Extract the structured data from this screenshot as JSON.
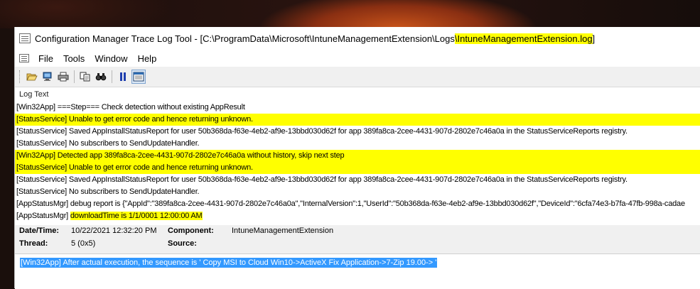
{
  "window": {
    "title_prefix": "Configuration Manager Trace Log Tool - [C:\\ProgramData\\Microsoft\\IntuneManagementExtension\\Logs",
    "title_highlight": "\\IntuneManagementExtension.log",
    "title_suffix": "]"
  },
  "menu": {
    "items": [
      "File",
      "Tools",
      "Window",
      "Help"
    ]
  },
  "toolbar": {
    "buttons": [
      "open-icon",
      "open-network-icon",
      "print-icon",
      "copy-icon",
      "find-icon",
      "pause-icon",
      "filter-icon"
    ]
  },
  "log": {
    "header": "Log Text",
    "rows": [
      {
        "pre": "[Win32App] ===Step=== Check detection without existing AppResult",
        "hl": "",
        "post": "",
        "highlight": false
      },
      {
        "pre": "[StatusService] Unable to get error code and hence returning unknown.",
        "hl": "",
        "post": "",
        "highlight": true
      },
      {
        "pre": "[StatusService] Saved AppInstallStatusReport for user 50b368da-f63e-4eb2-af9e-13bbd030d62f for app 389fa8ca-2cee-4431-907d-2802e7c46a0a in the StatusServiceReports registry.",
        "hl": "",
        "post": "",
        "highlight": false
      },
      {
        "pre": "[StatusService] No subscribers to SendUpdateHandler.",
        "hl": "",
        "post": "",
        "highlight": false
      },
      {
        "pre": "[Win32App] Detected app 389fa8ca-2cee-4431-907d-2802e7c46a0a without history, skip next step",
        "hl": "",
        "post": "",
        "highlight": true
      },
      {
        "pre": "[StatusService] Unable to get error code and hence returning unknown.",
        "hl": "",
        "post": "",
        "highlight": true
      },
      {
        "pre": "[StatusService] Saved AppInstallStatusReport for user 50b368da-f63e-4eb2-af9e-13bbd030d62f for app 389fa8ca-2cee-4431-907d-2802e7c46a0a in the StatusServiceReports registry.",
        "hl": "",
        "post": "",
        "highlight": false
      },
      {
        "pre": "[StatusService] No subscribers to SendUpdateHandler.",
        "hl": "",
        "post": "",
        "highlight": false
      },
      {
        "pre": "[AppStatusMgr] debug report is {\"AppId\":\"389fa8ca-2cee-4431-907d-2802e7c46a0a\",\"InternalVersion\":1,\"UserId\":\"50b368da-f63e-4eb2-af9e-13bbd030d62f\",\"DeviceId\":\"6cfa74e3-b7fa-47fb-998a-cadae",
        "hl": "",
        "post": "",
        "highlight": false
      },
      {
        "pre": "[AppStatusMgr] ",
        "hl": "downloadTime is 1/1/0001 12:00:00 AM",
        "post": "",
        "highlight": false
      }
    ]
  },
  "details": {
    "datetime_label": "Date/Time:",
    "datetime_value": "10/22/2021 12:32:20 PM",
    "component_label": "Component:",
    "component_value": "IntuneManagementExtension",
    "thread_label": "Thread:",
    "thread_value": "5 (0x5)",
    "source_label": "Source:",
    "source_value": ""
  },
  "message": {
    "text": "[Win32App] After actual execution, the sequence is ' Copy MSI to Cloud Win10->ActiveX Fix Application->7-Zip 19.00-> '"
  },
  "colors": {
    "highlight": "#ffff00",
    "selection": "#3399ff"
  }
}
